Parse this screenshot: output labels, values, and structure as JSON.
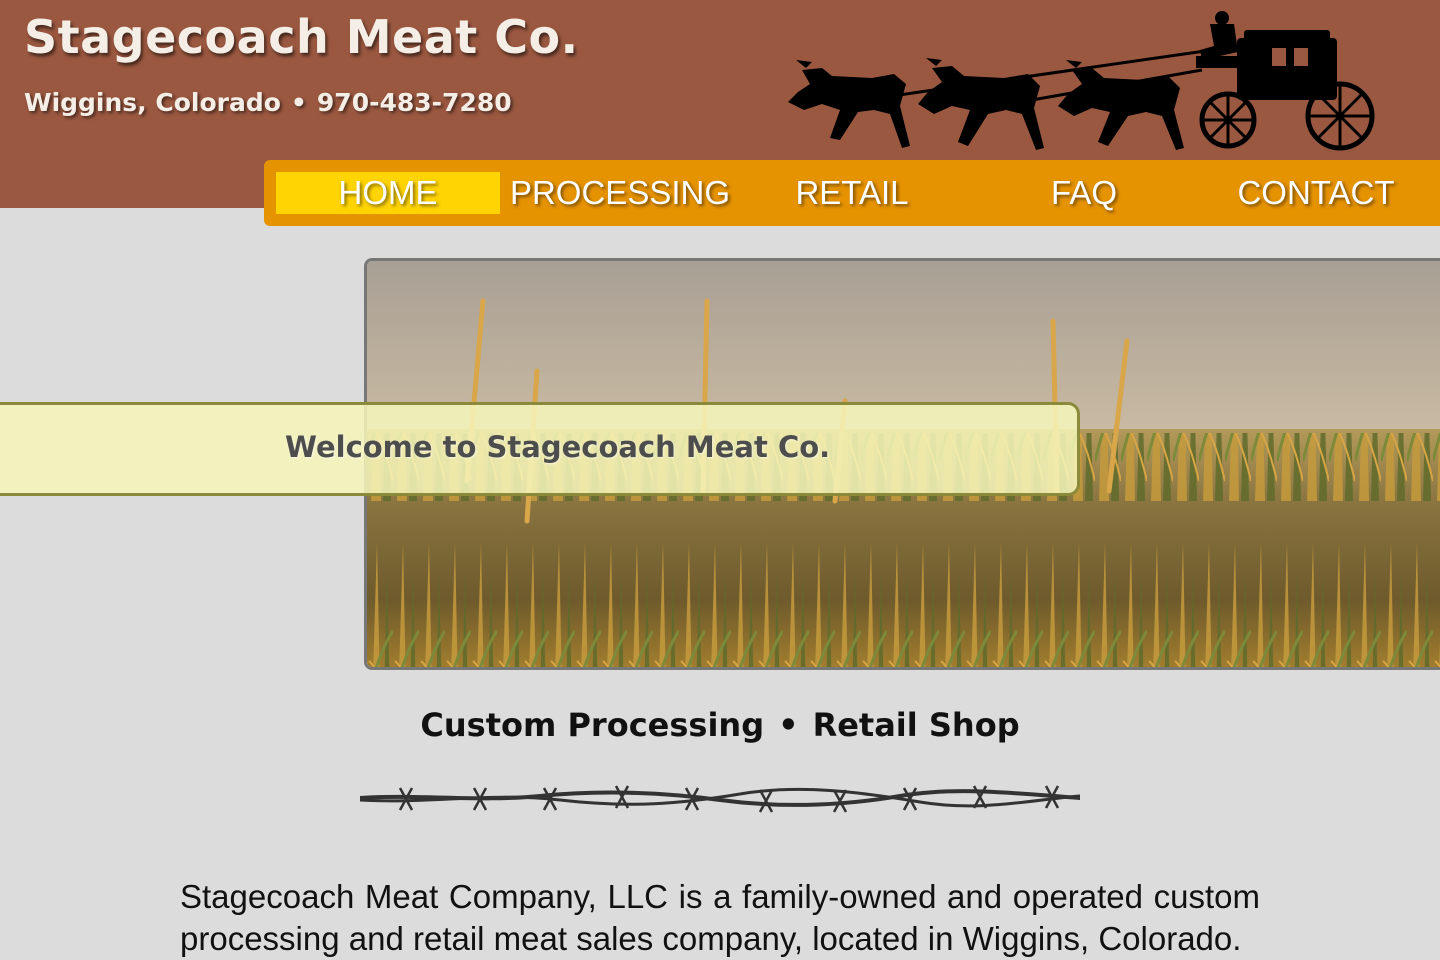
{
  "header": {
    "title": "Stagecoach Meat Co.",
    "location": "Wiggins, Colorado",
    "separator": "•",
    "phone": "970-483-7280",
    "logo_icon": "stagecoach-silhouette-icon",
    "background_color": "#9b5840"
  },
  "nav": {
    "background_color": "#e69300",
    "active_color": "#ffd400",
    "items": [
      {
        "label": "HOME",
        "active": true
      },
      {
        "label": "PROCESSING",
        "active": false
      },
      {
        "label": "RETAIL",
        "active": false
      },
      {
        "label": "FAQ",
        "active": false
      },
      {
        "label": "CONTACT",
        "active": false
      }
    ]
  },
  "hero": {
    "image": "cornfield-photo",
    "welcome": "Welcome to Stagecoach Meat Co."
  },
  "tagline": {
    "left": "Custom Processing",
    "separator": "•",
    "right": "Retail Shop"
  },
  "divider_icon": "barbed-wire-divider",
  "intro": "Stagecoach Meat Company, LLC is a family-owned and operated custom processing and retail meat sales company, located in Wiggins, Colorado."
}
